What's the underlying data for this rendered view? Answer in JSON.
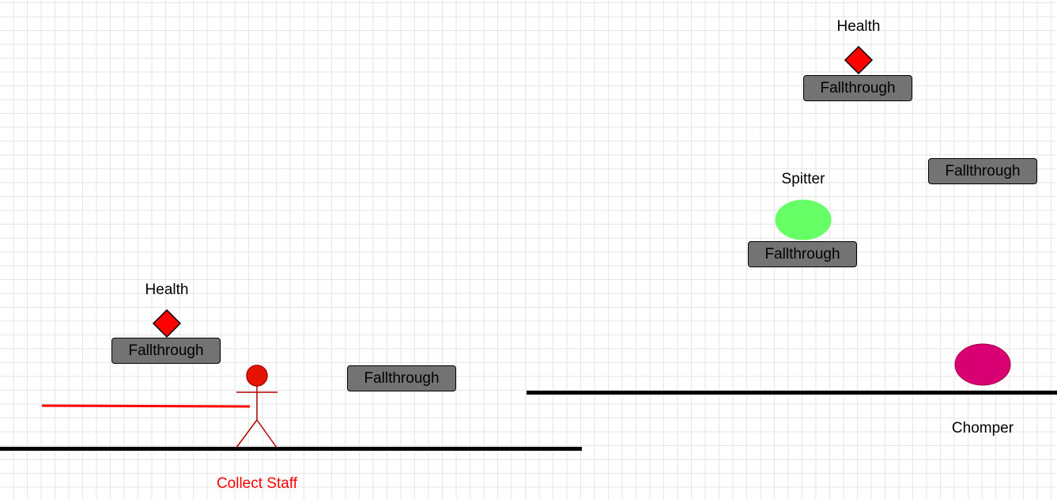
{
  "labels": {
    "health_left": "Health",
    "health_right": "Health",
    "spitter": "Spitter",
    "chomper": "Chomper",
    "collect_staff": "Collect Staff"
  },
  "platforms": [
    {
      "label": "Fallthrough"
    },
    {
      "label": "Fallthrough"
    },
    {
      "label": "Fallthrough"
    },
    {
      "label": "Fallthrough"
    },
    {
      "label": "Fallthrough"
    }
  ],
  "colors": {
    "health_pickup": "#ff0000",
    "spitter": "#66ff66",
    "chomper": "#d80073",
    "player": "#ff0000",
    "platform_fill": "#737373",
    "ground": "#000000",
    "grid": "#e6e6e6"
  },
  "icons": {
    "health": "red-diamond",
    "spitter": "green-ellipse",
    "chomper": "magenta-ellipse",
    "player": "stick-figure"
  }
}
